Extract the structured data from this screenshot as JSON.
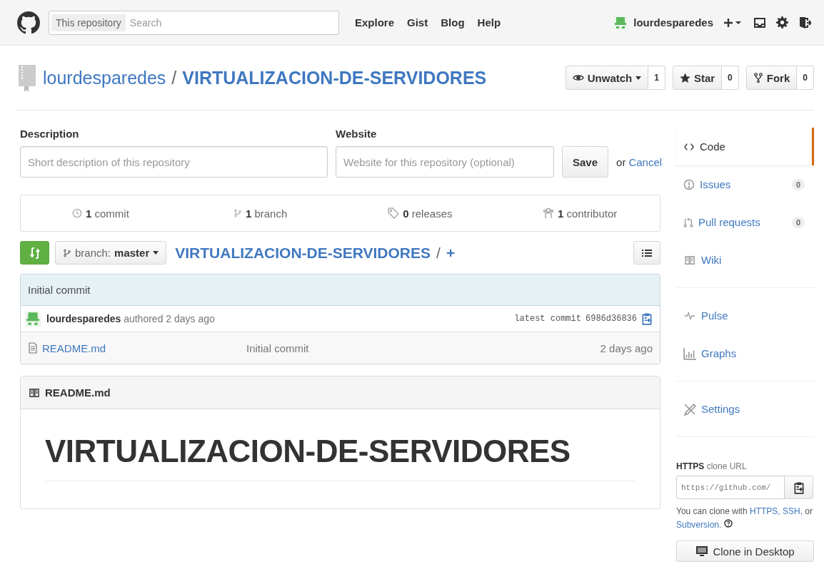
{
  "header": {
    "search_scope": "This repository",
    "search_placeholder": "Search",
    "nav": [
      "Explore",
      "Gist",
      "Blog",
      "Help"
    ],
    "user": "lourdesparedes"
  },
  "repo": {
    "owner": "lourdesparedes",
    "separator": "/",
    "name": "VIRTUALIZACION-DE-SERVIDORES",
    "actions": [
      {
        "kind": "watch",
        "label": "Unwatch",
        "count": "1"
      },
      {
        "kind": "star",
        "label": "Star",
        "count": "0"
      },
      {
        "kind": "fork",
        "label": "Fork",
        "count": "0"
      }
    ]
  },
  "edit": {
    "description_label": "Description",
    "description_placeholder": "Short description of this repository",
    "website_label": "Website",
    "website_placeholder": "Website for this repository (optional)",
    "save": "Save",
    "or": "or",
    "cancel": "Cancel"
  },
  "stats": [
    {
      "kind": "commit",
      "count": "1",
      "label": "commit"
    },
    {
      "kind": "branch",
      "count": "1",
      "label": "branch"
    },
    {
      "kind": "release",
      "count": "0",
      "label": "releases"
    },
    {
      "kind": "contributor",
      "count": "1",
      "label": "contributor"
    }
  ],
  "file_nav": {
    "branch_prefix": "branch:",
    "branch": "master",
    "path": "VIRTUALIZACION-DE-SERVIDORES",
    "separator": "/",
    "add": "+"
  },
  "commit": {
    "message": "Initial commit",
    "author": "lourdesparedes",
    "when": "authored 2 days ago",
    "label": "latest commit",
    "sha": "6986d36836"
  },
  "files": [
    {
      "name": "README.md",
      "message": "Initial commit",
      "age": "2 days ago"
    }
  ],
  "readme": {
    "title": "README.md",
    "heading": "VIRTUALIZACION-DE-SERVIDORES"
  },
  "sidebar": {
    "sections": [
      [
        {
          "kind": "code",
          "label": "Code",
          "selected": true
        },
        {
          "kind": "issue",
          "label": "Issues",
          "count": "0",
          "selected": false
        },
        {
          "kind": "pull",
          "label": "Pull requests",
          "count": "0",
          "selected": false
        },
        {
          "kind": "wiki",
          "label": "Wiki",
          "selected": false
        }
      ],
      [
        {
          "kind": "pulse",
          "label": "Pulse",
          "selected": false
        },
        {
          "kind": "graph",
          "label": "Graphs",
          "selected": false
        }
      ],
      [
        {
          "kind": "settings",
          "label": "Settings",
          "selected": false
        }
      ]
    ]
  },
  "clone": {
    "protocol": "HTTPS",
    "label": "clone URL",
    "url": "https://github.com/",
    "help": [
      {
        "kind": "text",
        "text": "You can clone with"
      },
      {
        "kind": "link",
        "text": "HTTPS,"
      },
      {
        "kind": "link",
        "text": "SSH,"
      },
      {
        "kind": "text",
        "text": "or"
      },
      {
        "kind": "link",
        "text": "Subversion."
      }
    ],
    "desktop": "Clone in Desktop"
  }
}
